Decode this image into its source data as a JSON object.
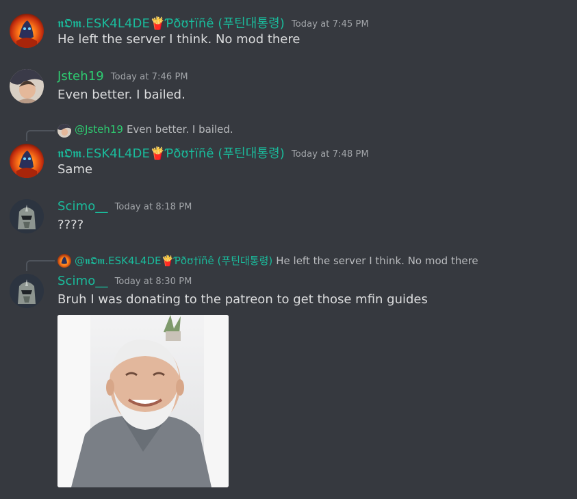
{
  "messages": [
    {
      "username": "𝖓𝕺𝖒.ESK4L4DE🍟Ƥðʊ†ïñê (푸틴대통령)",
      "timestamp": "Today at 7:45 PM",
      "text": "He left the server I think. No mod there"
    },
    {
      "username": "Jsteh19",
      "timestamp": "Today at 7:46 PM",
      "text": "Even better. I bailed."
    },
    {
      "reply": {
        "mention": "@Jsteh19",
        "text": "Even better. I bailed."
      },
      "username": "𝖓𝕺𝖒.ESK4L4DE🍟Ƥðʊ†ïñê (푸틴대통령)",
      "timestamp": "Today at 7:48 PM",
      "text": "Same"
    },
    {
      "username": "Scimo__",
      "timestamp": "Today at 8:18 PM",
      "text": "????"
    },
    {
      "reply": {
        "mention": "@𝖓𝕺𝖒.ESK4L4DE🍟Ƥðʊ†ïñê (푸틴대통령)",
        "text": "He left the server I think. No mod there"
      },
      "username": "Scimo__",
      "timestamp": "Today at 8:30 PM",
      "text": "Bruh I was donating to the patreon to get those mfin guides"
    }
  ],
  "colors": {
    "background": "#36393f",
    "teal_name": "#1abc9c",
    "green_name": "#2ecc71",
    "message_text": "#dcddde",
    "timestamp": "#a3a6aa"
  },
  "icons": {
    "avatar_1": "fire-demon-avatar",
    "avatar_2": "person-avatar",
    "avatar_3": "helmet-robot-avatar",
    "attachment": "smiling-old-man-photo"
  }
}
